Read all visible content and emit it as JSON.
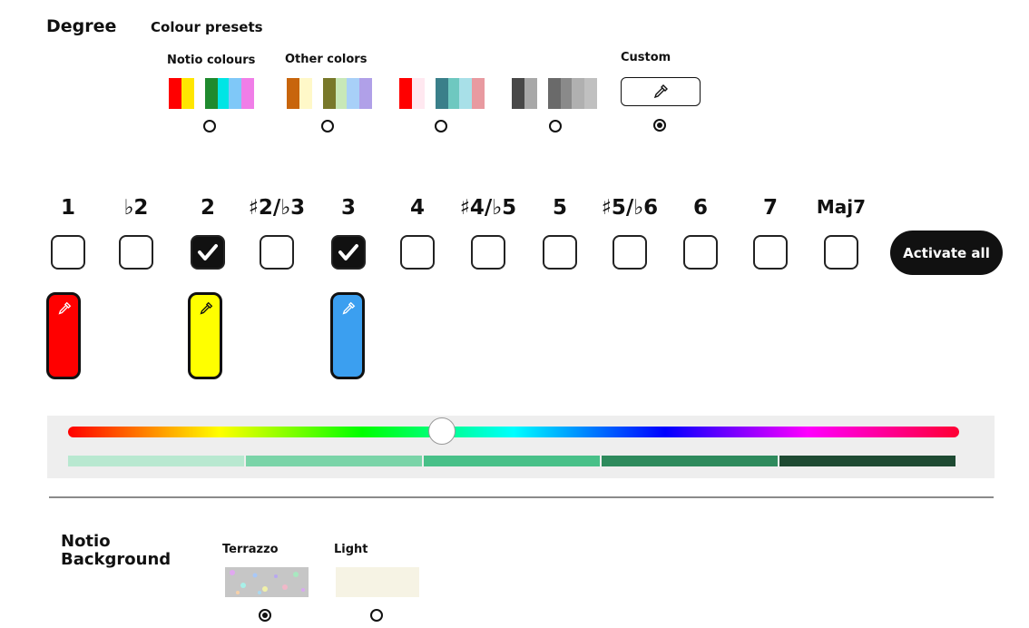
{
  "header": {
    "degree_title": "Degree",
    "colour_presets_title": "Colour presets"
  },
  "presets": {
    "notio_label": "Notio colours",
    "other_label": "Other colors",
    "custom_label": "Custom",
    "custom_icon": "eyedropper-icon",
    "groups": [
      {
        "colors": [
          "#ff0000",
          "#ffe600",
          "#ffffff",
          "#1f8a2e",
          "#00e5e5",
          "#7fc8f8",
          "#f07ee8"
        ],
        "selected": false
      },
      {
        "colors": [
          "#c8650c",
          "#fff8c8",
          "#ffffff",
          "#78782a",
          "#c8e8b8",
          "#a8d0f8",
          "#b0a0e8"
        ],
        "selected": false
      },
      {
        "colors": [
          "#ff0000",
          "#ffe8f0",
          "#ffffff",
          "#3a7f8a",
          "#6ec8c0",
          "#a8e0e8",
          "#e89aa0"
        ],
        "selected": false
      },
      {
        "colors": [
          "#484848",
          "#a8a8a8",
          "#ffffff",
          "#6a6a6a",
          "#8a8a8a",
          "#b0b0b0",
          "#c0c0c0"
        ],
        "selected": false
      }
    ],
    "custom_selected": true
  },
  "degrees": [
    {
      "label": "1",
      "checked": false
    },
    {
      "label": "♭2",
      "checked": false
    },
    {
      "label": "2",
      "checked": true
    },
    {
      "label": "♯2/♭3",
      "checked": false
    },
    {
      "label": "3",
      "checked": true
    },
    {
      "label": "4",
      "checked": false
    },
    {
      "label": "♯4/♭5",
      "checked": false
    },
    {
      "label": "5",
      "checked": false
    },
    {
      "label": "♯5/♭6",
      "checked": false
    },
    {
      "label": "6",
      "checked": false
    },
    {
      "label": "7",
      "checked": false
    },
    {
      "label": "Maj7",
      "checked": false
    }
  ],
  "activate_all_label": "Activate all",
  "degree_colors": [
    {
      "degree": "1",
      "color": "#ff0000",
      "icon_color": "#ffffff"
    },
    {
      "degree": "2",
      "color": "#ffff00",
      "icon_color": "#111111"
    },
    {
      "degree": "3",
      "color": "#3b9ff0",
      "icon_color": "#ffffff"
    }
  ],
  "picker": {
    "hue_position": 0.42,
    "shades": [
      "#b8e8d0",
      "#7ad4a8",
      "#48c088",
      "#2e8a5c",
      "#1e4a32"
    ]
  },
  "background": {
    "title_line1": "Notio",
    "title_line2": "Background",
    "options": [
      {
        "label": "Terrazzo",
        "selected": true
      },
      {
        "label": "Light",
        "selected": false
      }
    ],
    "light_color": "#f6f3e4"
  }
}
